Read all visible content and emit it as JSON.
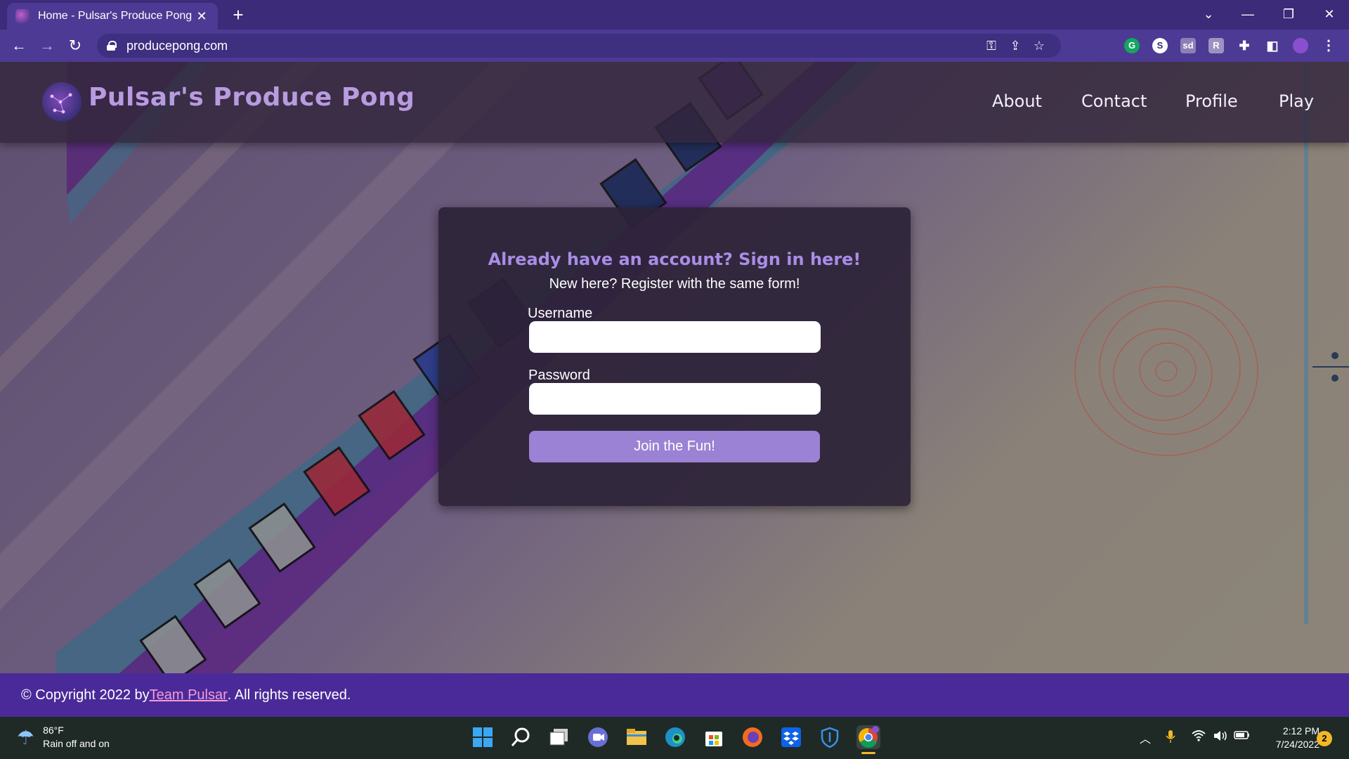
{
  "browser": {
    "tab_title": "Home - Pulsar's Produce Pong",
    "url": "producepong.com"
  },
  "site": {
    "title": "Pulsar's Produce Pong",
    "nav": [
      "About",
      "Contact",
      "Profile",
      "Play"
    ]
  },
  "login": {
    "heading": "Already have an account? Sign in here!",
    "subheading": "New here? Register with the same form!",
    "username_label": "Username",
    "username_value": "",
    "password_label": "Password",
    "password_value": "",
    "submit_label": "Join the Fun!"
  },
  "footer": {
    "prefix": "© Copyright 2022 by ",
    "link_text": "Team Pulsar",
    "suffix": ". All rights reserved."
  },
  "taskbar": {
    "temperature": "86°F",
    "weather_desc": "Rain off and on",
    "time": "2:12 PM",
    "date": "7/24/2022",
    "notification_count": "2"
  },
  "colors": {
    "chrome_bg": "#3b2b78",
    "accent_purple": "#a98de6",
    "button": "#9b82d4",
    "footer_bg": "#4a2a98",
    "footer_link": "#f59ad8"
  }
}
